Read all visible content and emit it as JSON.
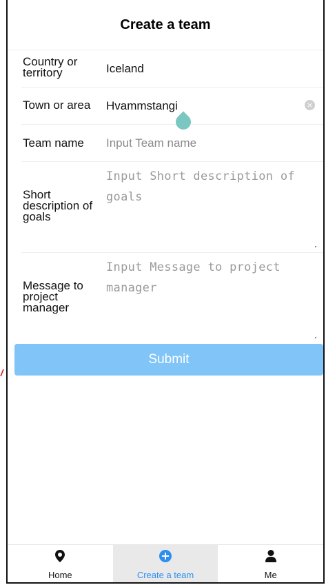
{
  "header": {
    "title": "Create a team"
  },
  "form": {
    "country": {
      "label": "Country or territory",
      "value": "Iceland"
    },
    "town": {
      "label": "Town or area",
      "value": "Hvammstangi",
      "clear_icon": "clear-circle-icon"
    },
    "team_name": {
      "label": "Team name",
      "placeholder": "Input Team name"
    },
    "goals": {
      "label": "Short description of goals",
      "placeholder": "Input Short description of goals"
    },
    "message": {
      "label": "Message to project manager",
      "placeholder": "Input Message to project manager"
    },
    "submit_label": "Submit"
  },
  "tabbar": {
    "tabs": [
      {
        "label": "Home",
        "icon": "map-pin-icon",
        "active": false
      },
      {
        "label": "Create a team",
        "icon": "plus-circle-icon",
        "active": true
      },
      {
        "label": "Me",
        "icon": "user-icon",
        "active": false
      }
    ]
  },
  "colors": {
    "accent": "#2c8ff0",
    "submit_bg": "#80c4f8",
    "selection_handle": "#79c7c0",
    "active_tab_bg": "#e9e9e9"
  }
}
